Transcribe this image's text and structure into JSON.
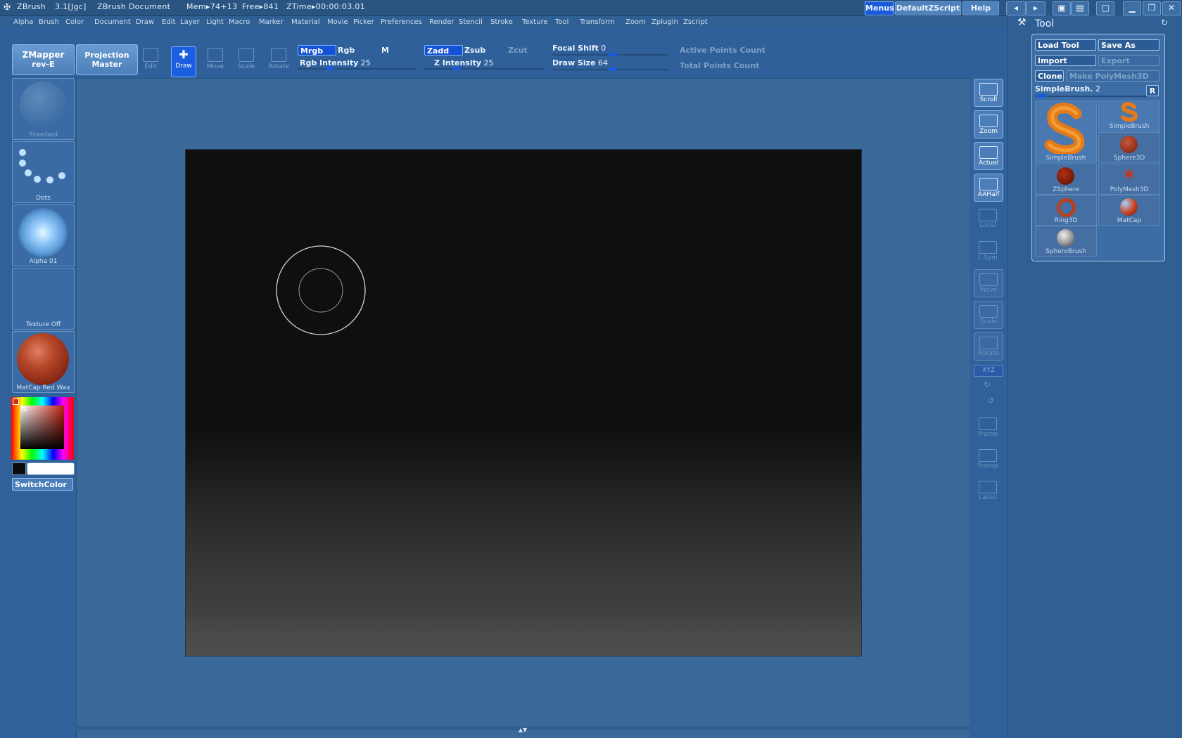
{
  "titlebar": {
    "app": "ZBrush",
    "version": "3.1[Jgc]",
    "document": "ZBrush Document",
    "mem": "Mem▸74+13",
    "free": "Free▸841",
    "ztime": "ZTime▸00:00:03.01",
    "menus_btn": "Menus",
    "script_btn": "DefaultZScript",
    "help_btn": "Help"
  },
  "menubar": [
    "Alpha",
    "Brush",
    "Color",
    "Document",
    "Draw",
    "Edit",
    "Layer",
    "Light",
    "Macro",
    "Marker",
    "Material",
    "Movie",
    "Picker",
    "Preferences",
    "Render",
    "Stencil",
    "Stroke",
    "Texture",
    "Tool",
    "Transform",
    "Zoom",
    "Zplugin",
    "Zscript"
  ],
  "toolbar": {
    "zmapper": {
      "line1": "ZMapper",
      "line2": "rev-E"
    },
    "projection": {
      "line1": "Projection",
      "line2": "Master"
    },
    "tools": [
      "Edit",
      "Draw",
      "Move",
      "Scale",
      "Rotate"
    ],
    "active_tool": "Draw",
    "mrgb": "Mrgb",
    "rgb": "Rgb",
    "m": "M",
    "rgb_intensity_label": "Rgb Intensity",
    "rgb_intensity": "25",
    "zadd": "Zadd",
    "zsub": "Zsub",
    "zcut": "Zcut",
    "z_intensity_label": "Z Intensity",
    "z_intensity": "25",
    "focal_shift_label": "Focal Shift",
    "focal_shift": "0",
    "draw_size_label": "Draw Size",
    "draw_size": "64",
    "active_points": "Active Points Count",
    "total_points": "Total Points Count"
  },
  "leftpanel": {
    "brush": "Standard",
    "stroke": "Dots",
    "alpha": "Alpha 01",
    "texture": "Texture Off",
    "material": "MatCap Red Wax",
    "switch_color": "SwitchColor"
  },
  "rightstrip": [
    "Scroll",
    "Zoom",
    "Actual",
    "AAHalf",
    "Local",
    "L.Sym",
    "Move",
    "Scale",
    "Rotate",
    "Frame",
    "Transp",
    "Lasso"
  ],
  "rightstrip_xyz": "XYZ",
  "toolpanel": {
    "title": "Tool",
    "load_tool": "Load Tool",
    "save_as": "Save As",
    "import": "Import",
    "export": "Export",
    "clone": "Clone",
    "make_polymesh": "Make PolyMesh3D",
    "current": "SimpleBrush.",
    "current_count": "2",
    "r_btn": "R",
    "tools": [
      "SimpleBrush",
      "SimpleBrush",
      "Sphere3D",
      "ZSphere",
      "PolyMesh3D",
      "Ring3D",
      "MatCap",
      "SphereBrush"
    ]
  },
  "colors": {
    "accent": "#1551d6",
    "background": "#3b6a9a",
    "canvas_top": "#0f0f0f",
    "material_sphere": "#a0391e"
  }
}
